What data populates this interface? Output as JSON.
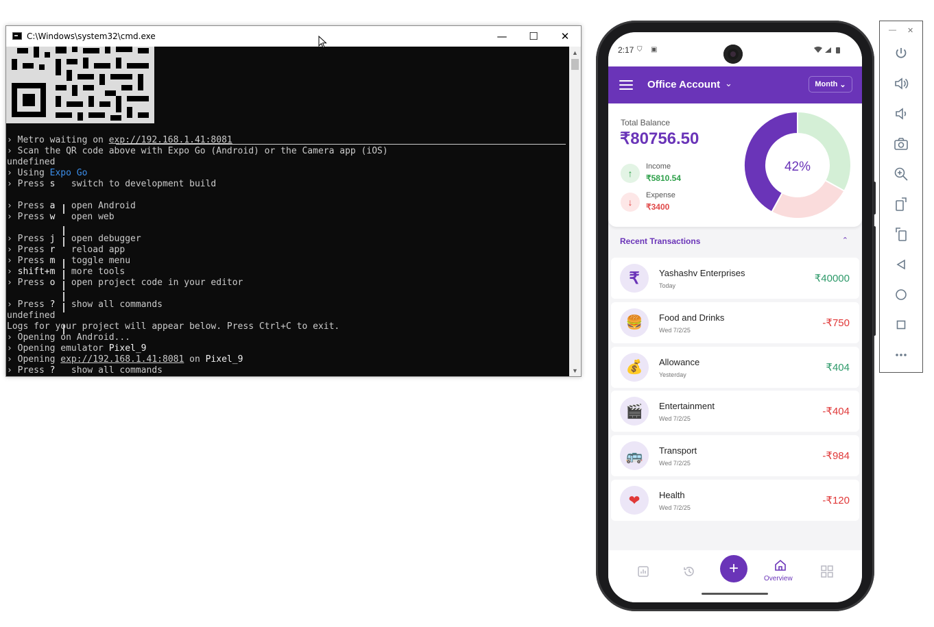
{
  "cmd": {
    "title": "C:\\Windows\\system32\\cmd.exe",
    "minimize": "—",
    "maximize": "☐",
    "close": "✕",
    "lines": [
      [
        {
          "t": "› Metro waiting on "
        },
        {
          "t": "exp://192.168.1.41:8081",
          "c": "ul"
        }
      ],
      [
        {
          "t": "› Scan the QR code above with Expo Go (Android) or the Camera app (iOS)"
        }
      ],
      [
        {
          "t": "undefined"
        }
      ],
      [
        {
          "t": "› Using "
        },
        {
          "t": "Expo Go",
          "c": "blue"
        }
      ],
      [
        {
          "t": "› Press "
        },
        {
          "t": "s",
          "c": "w"
        },
        {
          "t": "   switch to development build"
        }
      ],
      [
        {
          "t": ""
        }
      ],
      [
        {
          "t": "› Press "
        },
        {
          "t": "a",
          "c": "w"
        },
        {
          "t": "   open Android"
        }
      ],
      [
        {
          "t": "› Press "
        },
        {
          "t": "w",
          "c": "w"
        },
        {
          "t": "   open web"
        }
      ],
      [
        {
          "t": ""
        }
      ],
      [
        {
          "t": "› Press "
        },
        {
          "t": "j",
          "c": "w"
        },
        {
          "t": "   open debugger"
        }
      ],
      [
        {
          "t": "› Press "
        },
        {
          "t": "r",
          "c": "w"
        },
        {
          "t": "   reload app"
        }
      ],
      [
        {
          "t": "› Press "
        },
        {
          "t": "m",
          "c": "w"
        },
        {
          "t": "   toggle menu"
        }
      ],
      [
        {
          "t": "› "
        },
        {
          "t": "shift+m",
          "c": "w"
        },
        {
          "t": "   more tools"
        }
      ],
      [
        {
          "t": "› Press "
        },
        {
          "t": "o",
          "c": "w"
        },
        {
          "t": "   open project code in your editor"
        }
      ],
      [
        {
          "t": ""
        }
      ],
      [
        {
          "t": "› Press "
        },
        {
          "t": "?",
          "c": "w"
        },
        {
          "t": "   show all commands"
        }
      ],
      [
        {
          "t": "undefined"
        }
      ],
      [
        {
          "t": "Logs for your project will appear below. Press Ctrl+C to exit."
        }
      ],
      [
        {
          "t": "› Opening on Android..."
        }
      ],
      [
        {
          "t": "› Opening emulator "
        },
        {
          "t": "Pixel_9",
          "c": "w"
        }
      ],
      [
        {
          "t": "› Opening "
        },
        {
          "t": "exp://192.168.1.41:8081",
          "c": "ul"
        },
        {
          "t": " on "
        },
        {
          "t": "Pixel_9",
          "c": "w"
        }
      ],
      [
        {
          "t": "› Press "
        },
        {
          "t": "?",
          "c": "w"
        },
        {
          "t": "   show all commands"
        }
      ]
    ]
  },
  "phone": {
    "status_time": "2:17",
    "header": {
      "account": "Office Account",
      "period": "Month"
    },
    "balance": {
      "label": "Total Balance",
      "value": "₹80756.50",
      "income_label": "Income",
      "income_value": "₹5810.54",
      "expense_label": "Expense",
      "expense_value": "₹3400",
      "percent": "42%",
      "segments": [
        {
          "fraction": 0.42,
          "color": "#6a34b8"
        },
        {
          "fraction": 0.25,
          "color": "#fadcdc"
        },
        {
          "fraction": 0.33,
          "color": "#d4efd6"
        }
      ]
    },
    "recent_title": "Recent Transactions",
    "transactions": [
      {
        "name": "Yashashv Enterprises",
        "date": "Today",
        "amount": "₹40000",
        "icon": "rupee-icon",
        "glyph": "₹"
      },
      {
        "name": "Food and Drinks",
        "date": "Wed 7/2/25",
        "amount": "-₹750",
        "icon": "food-icon",
        "glyph": "🍔"
      },
      {
        "name": "Allowance",
        "date": "Yesterday",
        "amount": "₹404",
        "icon": "allowance-icon",
        "glyph": "💰"
      },
      {
        "name": "Entertainment",
        "date": "Wed 7/2/25",
        "amount": "-₹404",
        "icon": "entertainment-icon",
        "glyph": "🎬"
      },
      {
        "name": "Transport",
        "date": "Wed 7/2/25",
        "amount": "-₹984",
        "icon": "transport-icon",
        "glyph": "🚌"
      },
      {
        "name": "Health",
        "date": "Wed 7/2/25",
        "amount": "-₹120",
        "icon": "health-icon",
        "glyph": "❤"
      }
    ],
    "nav": {
      "overview_label": "Overview"
    }
  },
  "emulator": {
    "buttons": [
      "power-icon",
      "volume-up-icon",
      "volume-down-icon",
      "camera-icon",
      "zoom-icon",
      "rotate-left-icon",
      "rotate-right-icon",
      "back-icon",
      "home-icon",
      "overview-icon",
      "more-icon"
    ]
  },
  "colors": {
    "brand": "#6a34b8",
    "positive": "#2e9a6a",
    "negative": "#e03838",
    "terminal_bg": "#0c0c0c"
  }
}
